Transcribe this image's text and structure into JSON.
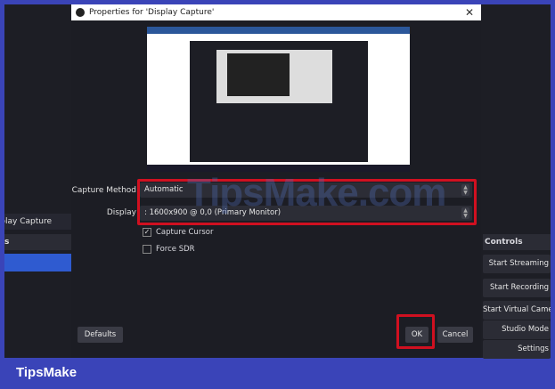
{
  "dialog": {
    "title": "Properties for 'Display Capture'",
    "close": "✕"
  },
  "fields": {
    "capture_method_label": "Capture Method",
    "capture_method_value": "Automatic",
    "display_label": "Display",
    "display_value": ": 1600x900 @ 0,0 (Primary Monitor)"
  },
  "checkboxes": [
    {
      "label": "Capture Cursor",
      "checked": true
    },
    {
      "label": "Force SDR",
      "checked": false
    }
  ],
  "buttons": {
    "defaults": "Defaults",
    "ok": "OK",
    "cancel": "Cancel"
  },
  "left_panel": {
    "source": "Display Capture",
    "header": "s"
  },
  "controls": {
    "header": "Controls",
    "items": [
      "Start Streaming",
      "Start Recording",
      "Start Virtual Camera",
      "Studio Mode",
      "Settings"
    ]
  },
  "footer": {
    "brand": "TipsMake"
  },
  "watermark": "TipsMake.com",
  "colors": {
    "border": "#3a44b8",
    "highlight": "#d01020",
    "selected": "#2f5bd0"
  }
}
